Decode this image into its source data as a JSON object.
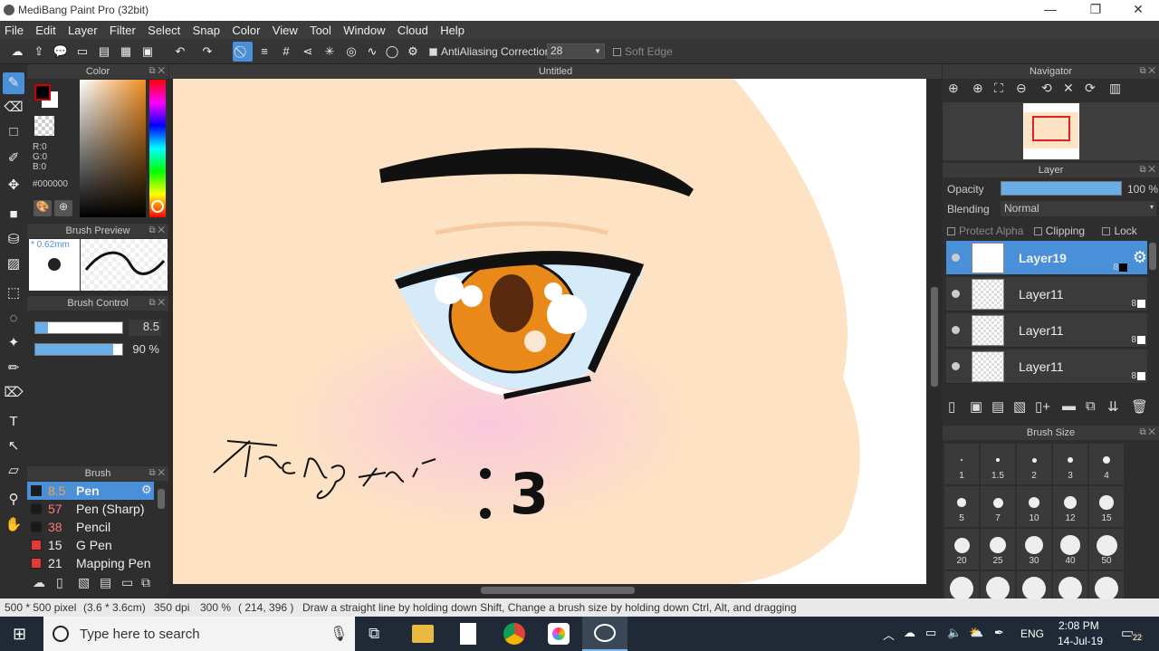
{
  "window": {
    "title": "MediBang Paint Pro (32bit)",
    "minimize": "—",
    "restore": "❐",
    "close": "✕"
  },
  "menu": [
    "File",
    "Edit",
    "Layer",
    "Filter",
    "Select",
    "Snap",
    "Color",
    "View",
    "Tool",
    "Window",
    "Cloud",
    "Help"
  ],
  "toolbar": {
    "antialiasing_label": "AntiAliasing",
    "correction_label": "Correction",
    "correction_value": "28",
    "soft_edge_label": "Soft Edge"
  },
  "color_panel": {
    "title": "Color",
    "r": "R:0",
    "g": "G:0",
    "b": "B:0",
    "hex": "#000000"
  },
  "brush_preview": {
    "title": "Brush Preview",
    "size": "* 0.62mm"
  },
  "brush_control": {
    "title": "Brush Control",
    "size_value": "8.5",
    "opacity_value": "90 %",
    "size_fill": 0.15,
    "opacity_fill": 0.9
  },
  "brush_panel": {
    "title": "Brush",
    "items": [
      {
        "size": "8.5",
        "name": "Pen",
        "color": "#1a1a1a",
        "selected": true
      },
      {
        "size": "57",
        "name": "Pen (Sharp)",
        "color": "#1a1a1a"
      },
      {
        "size": "38",
        "name": "Pencil",
        "color": "#1a1a1a"
      },
      {
        "size": "15",
        "name": "G Pen",
        "color": "#e53935"
      },
      {
        "size": "21",
        "name": "Mapping Pen",
        "color": "#e53935"
      }
    ]
  },
  "canvas": {
    "title": "Untitled",
    "text_doodle": "Trang trí  :3"
  },
  "navigator": {
    "title": "Navigator"
  },
  "layer_panel": {
    "title": "Layer",
    "opacity_label": "Opacity",
    "opacity_value": "100 %",
    "opacity_fill": 1.0,
    "blending_label": "Blending",
    "blending_value": "Normal",
    "protect_alpha": "Protect Alpha",
    "clipping": "Clipping",
    "lock": "Lock",
    "layers": [
      {
        "name": "Layer19",
        "num": "8",
        "selected": true
      },
      {
        "name": "Layer11",
        "num": "8"
      },
      {
        "name": "Layer11",
        "num": "8"
      },
      {
        "name": "Layer11",
        "num": "8"
      }
    ]
  },
  "brush_size_panel": {
    "title": "Brush Size",
    "sizes": [
      "1",
      "1.5",
      "2",
      "3",
      "4",
      "5",
      "7",
      "10",
      "12",
      "15",
      "20",
      "25",
      "30",
      "40",
      "50"
    ]
  },
  "status": {
    "dims": "500 * 500 pixel",
    "cm": "(3.6 * 3.6cm)",
    "dpi": "350 dpi",
    "zoom": "300 %",
    "coords": "( 214, 396 )",
    "hint": "Draw a straight line by holding down Shift, Change a brush size by holding down Ctrl, Alt, and dragging"
  },
  "taskbar": {
    "search_placeholder": "Type here to search",
    "lang": "ENG",
    "time": "2:08 PM",
    "date": "14-Jul-19",
    "notifications": "22"
  }
}
